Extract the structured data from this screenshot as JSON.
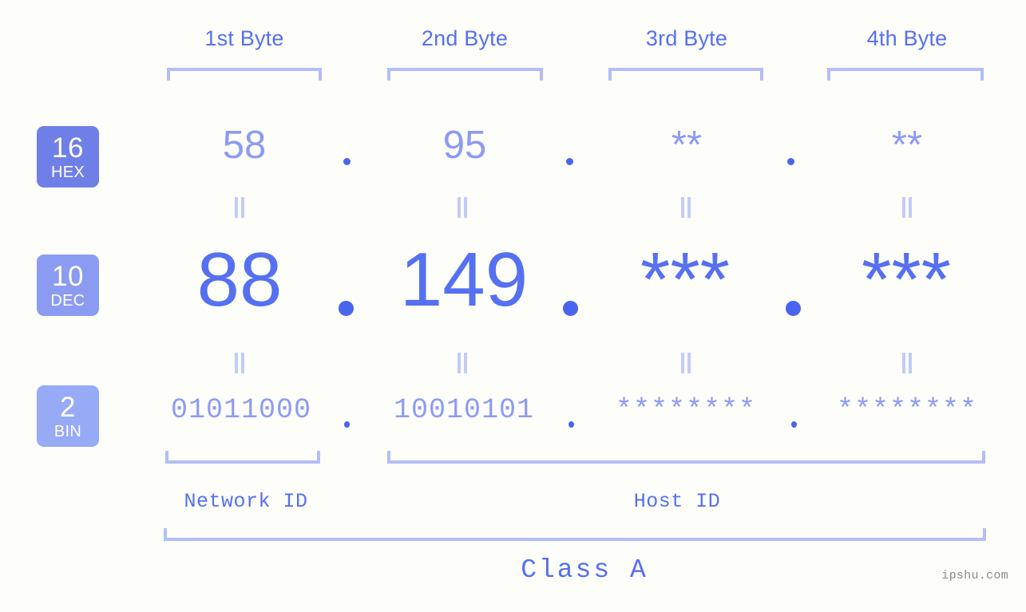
{
  "theme": {
    "background": "#fdfdfa",
    "accent_strong": "#5570f0",
    "accent_mid": "#8c9bf2",
    "accent_light": "#b3bdf7",
    "dot_color": "#4964ee",
    "badge_hex_bg": "#6f7fe8",
    "badge_dec_bg": "#8c9bf2",
    "badge_bin_bg": "#97aaf6",
    "watermark_color": "#8a8a8a"
  },
  "byte_headers": [
    {
      "label": "1st Byte"
    },
    {
      "label": "2nd Byte"
    },
    {
      "label": "3rd Byte"
    },
    {
      "label": "4th Byte"
    }
  ],
  "bases": [
    {
      "number": "16",
      "name": "HEX"
    },
    {
      "number": "10",
      "name": "DEC"
    },
    {
      "number": "2",
      "name": "BIN"
    }
  ],
  "rows": {
    "hex": {
      "values": [
        "58",
        "95",
        "**",
        "**"
      ]
    },
    "dec": {
      "values": [
        "88",
        "149",
        "***",
        "***"
      ]
    },
    "bin": {
      "values": [
        "01011000",
        "10010101",
        "********",
        "********"
      ]
    }
  },
  "separators": {
    "hex": [
      ".",
      ".",
      "."
    ],
    "dec": [
      ".",
      ".",
      "."
    ],
    "bin": [
      ".",
      ".",
      "."
    ]
  },
  "equivalence_marks": {
    "glyph": "||",
    "count_per_gap": 4,
    "gaps": 2
  },
  "segments": [
    {
      "label": "Network ID"
    },
    {
      "label": "Host ID"
    }
  ],
  "class": {
    "label": "Class A"
  },
  "watermark": {
    "text": "ipshu.com"
  }
}
